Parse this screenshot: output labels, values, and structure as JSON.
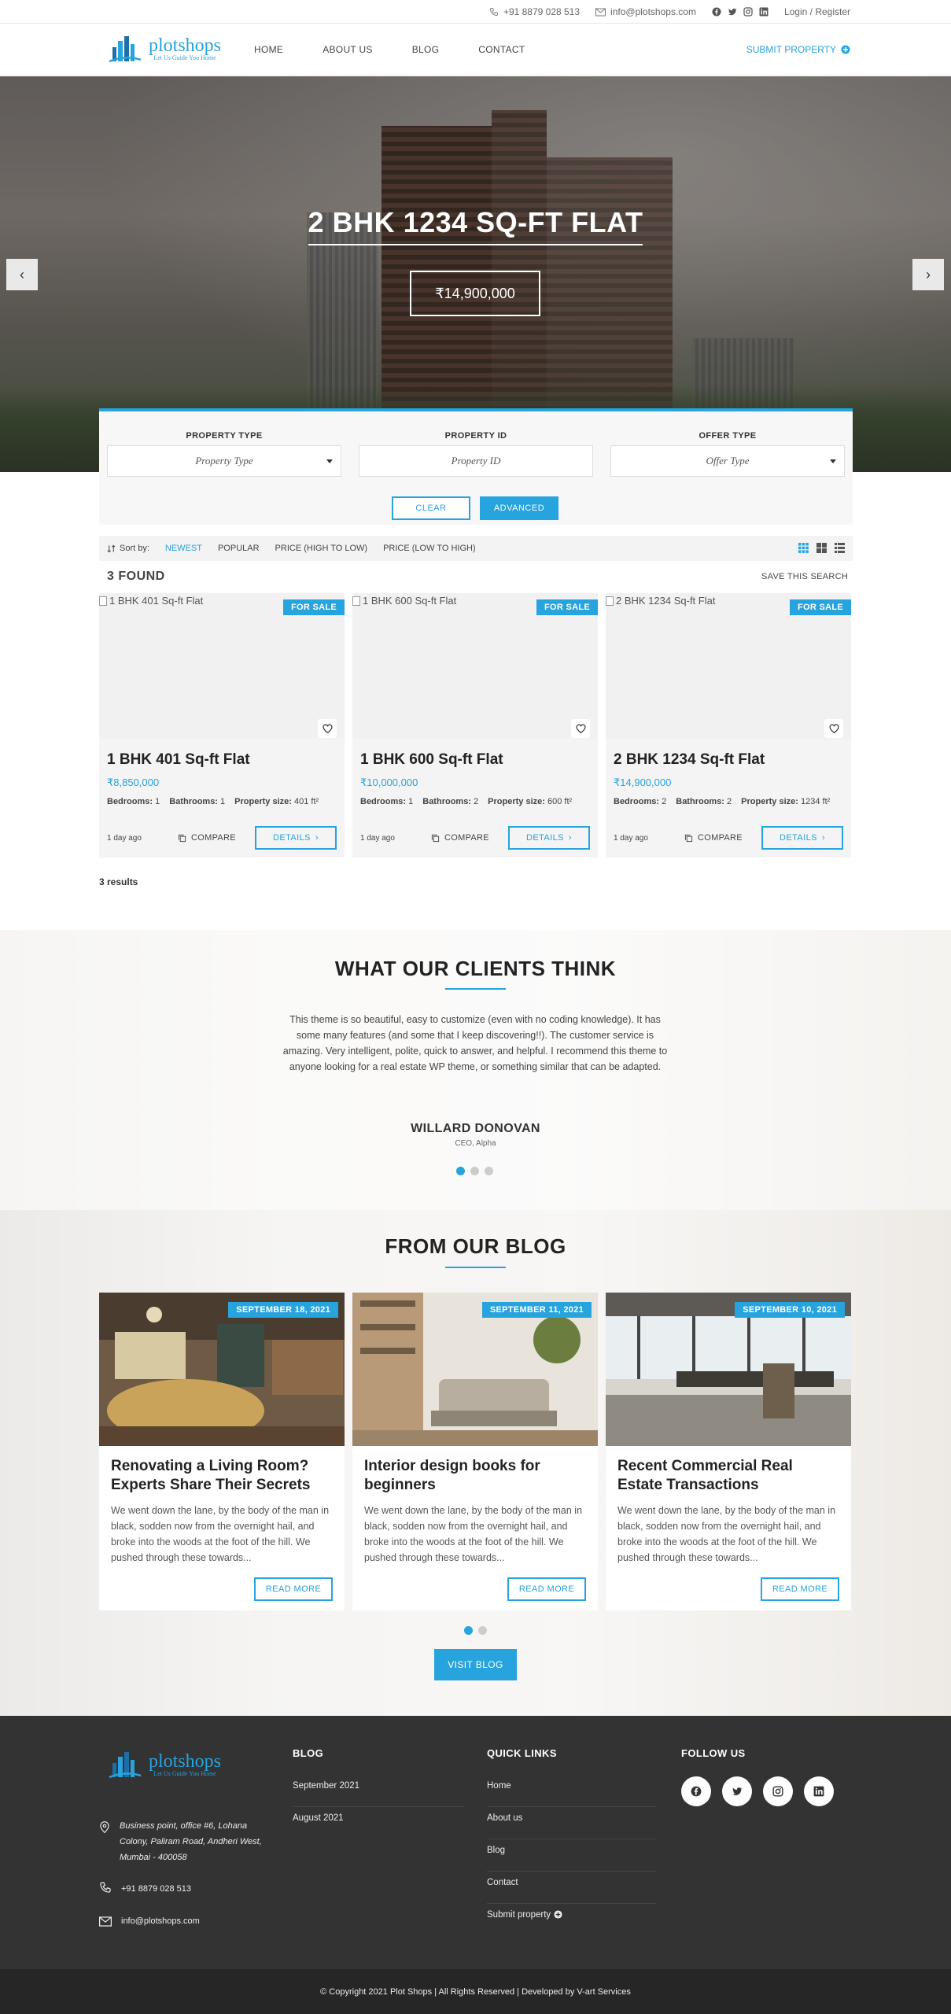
{
  "topbar": {
    "phone": "+91 8879 028 513",
    "email": "info@plotshops.com",
    "social": [
      "facebook-icon",
      "twitter-icon",
      "instagram-icon",
      "linkedin-icon"
    ],
    "login": "Login / Register"
  },
  "header": {
    "logo_name": "plotshops",
    "logo_tagline": "Let Us Guide You Home",
    "nav": [
      "HOME",
      "ABOUT US",
      "BLOG",
      "CONTACT"
    ],
    "submit": "SUBMIT PROPERTY"
  },
  "hero": {
    "title": "2 BHK 1234 SQ-FT FLAT",
    "price": "₹14,900,000",
    "prev": "‹",
    "next": "›"
  },
  "search": {
    "property_type_label": "PROPERTY TYPE",
    "property_type_value": "Property Type",
    "property_id_label": "PROPERTY ID",
    "property_id_placeholder": "Property ID",
    "offer_type_label": "OFFER TYPE",
    "offer_type_value": "Offer Type",
    "clear": "CLEAR",
    "advanced": "ADVANCED"
  },
  "sort": {
    "label": "Sort by:",
    "options": [
      "NEWEST",
      "POPULAR",
      "PRICE (HIGH TO LOW)",
      "PRICE (LOW TO HIGH)"
    ],
    "active": "NEWEST"
  },
  "listing": {
    "found": "3 FOUND",
    "save_search": "SAVE THIS SEARCH",
    "results": "3 results",
    "properties": [
      {
        "img_alt": "1 BHK 401 Sq-ft Flat",
        "badge": "FOR SALE",
        "title": "1 BHK 401 Sq-ft Flat",
        "price": "₹8,850,000",
        "bedrooms_label": "Bedrooms:",
        "bedrooms": "1",
        "bathrooms_label": "Bathrooms:",
        "bathrooms": "1",
        "size_label": "Property size:",
        "size": "401 ft²",
        "age": "1 day ago",
        "compare": "COMPARE",
        "details": "DETAILS"
      },
      {
        "img_alt": "1 BHK 600 Sq-ft Flat",
        "badge": "FOR SALE",
        "title": "1 BHK 600 Sq-ft Flat",
        "price": "₹10,000,000",
        "bedrooms_label": "Bedrooms:",
        "bedrooms": "1",
        "bathrooms_label": "Bathrooms:",
        "bathrooms": "2",
        "size_label": "Property size:",
        "size": "600 ft²",
        "age": "1 day ago",
        "compare": "COMPARE",
        "details": "DETAILS"
      },
      {
        "img_alt": "2 BHK 1234 Sq-ft Flat",
        "badge": "FOR SALE",
        "title": "2 BHK 1234 Sq-ft Flat",
        "price": "₹14,900,000",
        "bedrooms_label": "Bedrooms:",
        "bedrooms": "2",
        "bathrooms_label": "Bathrooms:",
        "bathrooms": "2",
        "size_label": "Property size:",
        "size": "1234 ft²",
        "age": "1 day ago",
        "compare": "COMPARE",
        "details": "DETAILS"
      }
    ]
  },
  "testimonials": {
    "title": "WHAT OUR CLIENTS THINK",
    "quote": "This theme is so beautiful, easy to customize (even with no coding knowledge). It has some many features (and some that I keep discovering!!). The customer service is amazing. Very intelligent, polite, quick to answer, and helpful. I recommend this theme to anyone looking for a real estate WP theme, or something similar that can be adapted.",
    "name": "WILLARD DONOVAN",
    "role": "CEO, Alpha"
  },
  "blog": {
    "title": "FROM OUR BLOG",
    "posts": [
      {
        "date": "SEPTEMBER 18, 2021",
        "title": "Renovating a Living Room? Experts Share Their Secrets",
        "excerpt": "We went down the lane, by the body of the man in black, sodden now from the overnight hail, and broke into the woods at the foot of the hill. We pushed through these towards...",
        "more": "READ MORE"
      },
      {
        "date": "SEPTEMBER 11, 2021",
        "title": "Interior design books for beginners",
        "excerpt": "We went down the lane, by the body of the man in black, sodden now from the overnight hail, and broke into the woods at the foot of the hill. We pushed through these towards...",
        "more": "READ MORE"
      },
      {
        "date": "SEPTEMBER 10, 2021",
        "title": "Recent Commercial Real Estate Transactions",
        "excerpt": "We went down the lane, by the body of the man in black, sodden now from the overnight hail, and broke into the woods at the foot of the hill. We pushed through these towards...",
        "more": "READ MORE"
      }
    ],
    "visit": "VISIT BLOG"
  },
  "footer": {
    "logo_name": "plotshops",
    "logo_tagline": "Let Us Guide You Home",
    "address": "Business point, office #6, Lohana Colony, Paliram Road, Andheri West, Mumbai - 400058",
    "phone": "+91 8879 028 513",
    "email": "info@plotshops.com",
    "blog_head": "BLOG",
    "blog_links": [
      "September 2021",
      "August 2021"
    ],
    "quick_head": "QUICK LINKS",
    "quick_links": [
      "Home",
      "About us",
      "Blog",
      "Contact",
      "Submit property"
    ],
    "follow_head": "FOLLOW US",
    "copyright": "© Copyright 2021 Plot Shops | All Rights Reserved | Developed by V-art Services"
  },
  "colors": {
    "accent": "#27a3dd",
    "footer_bg": "#333333",
    "copyright_bg": "#262626"
  }
}
